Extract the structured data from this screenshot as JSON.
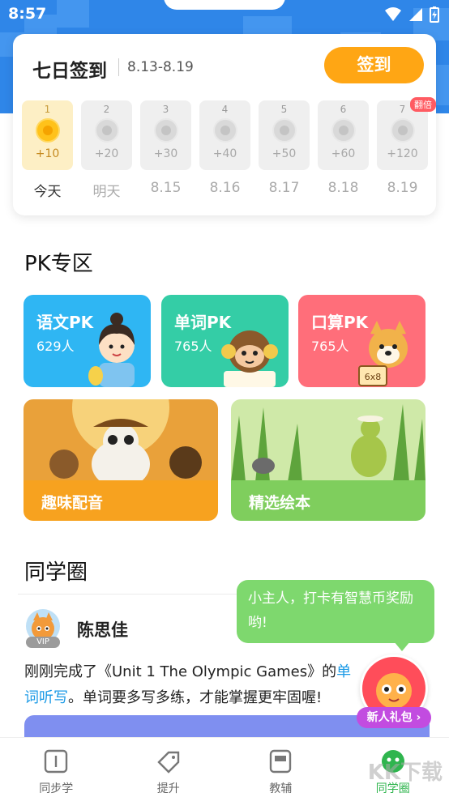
{
  "status_bar": {
    "time": "8:57"
  },
  "checkin": {
    "title": "七日签到",
    "date_range": "8.13-8.19",
    "button_label": "签到",
    "double_badge": "翻倍",
    "days": [
      {
        "num": "1",
        "reward": "+10",
        "label": "今天"
      },
      {
        "num": "2",
        "reward": "+20",
        "label": "明天"
      },
      {
        "num": "3",
        "reward": "+30",
        "label": "8.15"
      },
      {
        "num": "4",
        "reward": "+40",
        "label": "8.16"
      },
      {
        "num": "5",
        "reward": "+50",
        "label": "8.17"
      },
      {
        "num": "6",
        "reward": "+60",
        "label": "8.18"
      },
      {
        "num": "7",
        "reward": "+120",
        "label": "8.19"
      }
    ]
  },
  "pk_section": {
    "title": "PK专区",
    "cards": [
      {
        "name": "语文PK",
        "count": "629人",
        "color": "#2fb6f3"
      },
      {
        "name": "单词PK",
        "count": "765人",
        "color": "#34cda6"
      },
      {
        "name": "口算PK",
        "count": "765人",
        "color": "#ff6e7a"
      }
    ]
  },
  "features": [
    {
      "label": "趣味配音",
      "color": "#f7a21f"
    },
    {
      "label": "精选绘本",
      "color": "#7fce5d"
    }
  ],
  "classmates": {
    "title": "同学圈",
    "post": {
      "author": "陈思佳",
      "vip": "VIP",
      "text_before": "刚刚完成了《Unit 1 The Olympic Games》的",
      "link_text": "单词听写",
      "text_after": "。单词要多写多练，才能掌握更牢固喔!"
    }
  },
  "bubble": {
    "text": "小主人，打卡有智慧币奖励哟!"
  },
  "gift": {
    "label": "新人礼包 ›"
  },
  "bottom_nav": [
    {
      "label": "同步学",
      "icon": "book-icon"
    },
    {
      "label": "提升",
      "icon": "tag-icon"
    },
    {
      "label": "教辅",
      "icon": "textbook-icon"
    },
    {
      "label": "同学圈",
      "icon": "friends-icon"
    }
  ],
  "watermark": "KK下载"
}
